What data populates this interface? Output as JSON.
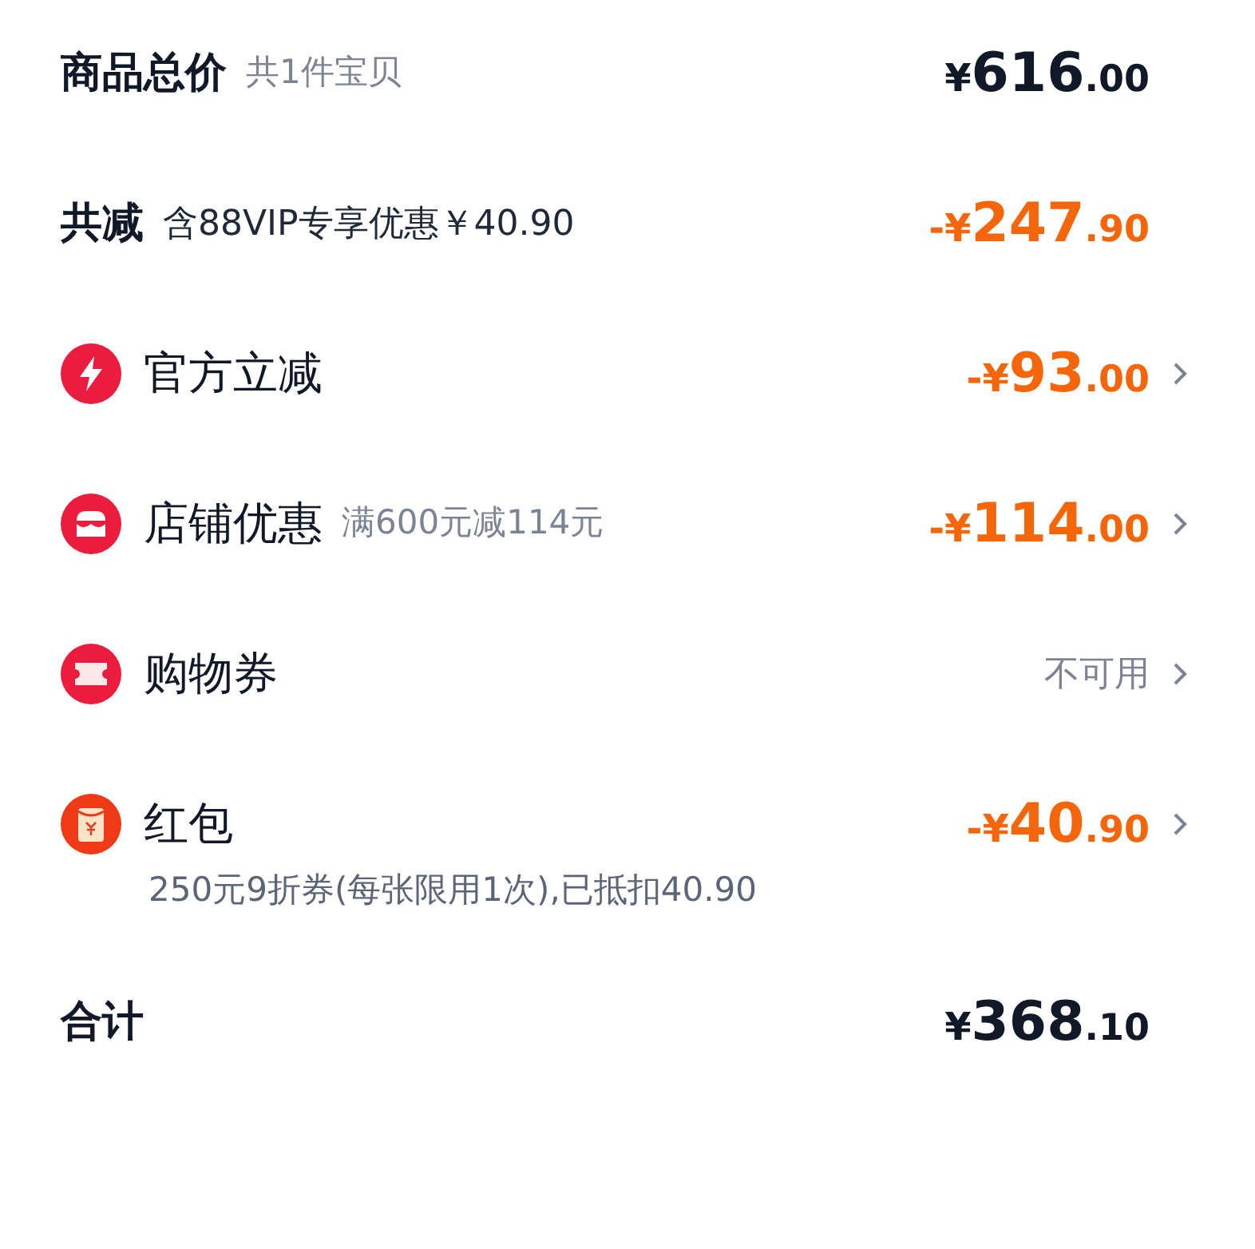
{
  "rows": [
    {
      "kind": "header",
      "title": "商品总价",
      "note": "共1件宝贝",
      "amount": {
        "color": "#111827",
        "sign": "¥",
        "integer": "616",
        "decimal": ".00"
      },
      "arrow": false
    },
    {
      "kind": "header",
      "title": "共减",
      "note": "含88VIP专享优惠￥40.90",
      "amount": {
        "color": "#f5650a",
        "sign": "-¥",
        "integer": "247",
        "decimal": ".90"
      },
      "arrow": false
    },
    {
      "kind": "item",
      "title": "官方立减",
      "amount": {
        "color": "#f5650a",
        "sign": "-¥",
        "integer": "93",
        "decimal": ".00"
      },
      "arrow": true
    },
    {
      "kind": "item",
      "title": "店铺优惠",
      "note": "满600元减114元",
      "amount": {
        "color": "#f5650a",
        "sign": "-¥",
        "integer": "114",
        "decimal": ".00"
      },
      "arrow": true
    },
    {
      "kind": "item",
      "title": "购物券",
      "status": "不可用",
      "arrow": true
    },
    {
      "kind": "item",
      "title": "红包",
      "amount": {
        "color": "#f5650a",
        "sign": "-¥",
        "integer": "40",
        "decimal": ".90"
      },
      "arrow": true,
      "detail": "250元9折券(每张限用1次),已抵扣40.90"
    },
    {
      "kind": "header",
      "title": "合计",
      "amount": {
        "color": "#111827",
        "sign": "¥",
        "integer": "368",
        "decimal": ".10"
      },
      "arrow": false
    }
  ]
}
